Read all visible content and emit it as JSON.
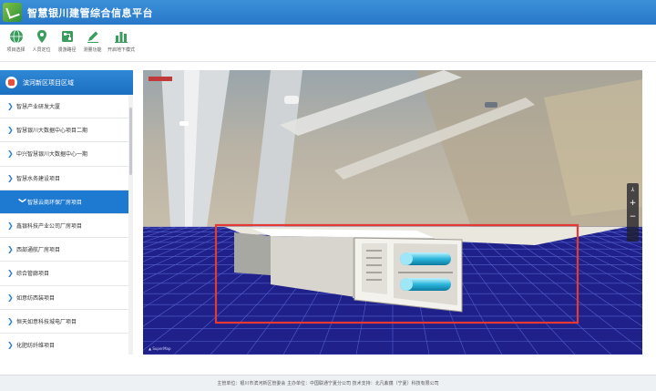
{
  "header": {
    "title": "智慧银川建管综合信息平台"
  },
  "toolbar": {
    "items": [
      {
        "label": "项目选择",
        "icon": "globe-icon"
      },
      {
        "label": "人员定位",
        "icon": "location-pin-icon"
      },
      {
        "label": "漫游路径",
        "icon": "route-icon"
      },
      {
        "label": "测量功能",
        "icon": "measure-pencil-icon"
      },
      {
        "label": "开启地下模式",
        "icon": "underground-mode-icon"
      }
    ]
  },
  "sidebar": {
    "header": "滨河新区项目区域",
    "items": [
      {
        "label": "智慧产业研发大厦"
      },
      {
        "label": "智慧银川大数据中心项目二期"
      },
      {
        "label": "中兴智慧银川大数据中心一期"
      },
      {
        "label": "智慧水务建设项目"
      },
      {
        "label": "智慧云商环保厂房项目"
      },
      {
        "label": "鑫银科技产业公司厂房项目"
      },
      {
        "label": "西部通航厂房项目"
      },
      {
        "label": "综合管廊项目"
      },
      {
        "label": "如意纺西装项目"
      },
      {
        "label": "恒天如意科技城电厂项目"
      },
      {
        "label": "化肥纺纤维项目"
      }
    ],
    "active_index": 4
  },
  "viewport": {
    "zoom_in": "+",
    "zoom_out": "−",
    "compass": "⅄"
  },
  "footer": {
    "text": "主管单位：银川市滨河新区管委会    主办单位：中国联通宁夏分公司    技术支持：北凡紫蕴（宁夏）科技有限公司"
  },
  "colors": {
    "header_blue": "#2b7fce",
    "sidebar_active": "#1e7ad0",
    "highlight_red": "#e53935",
    "grid_navy": "#20208a"
  }
}
